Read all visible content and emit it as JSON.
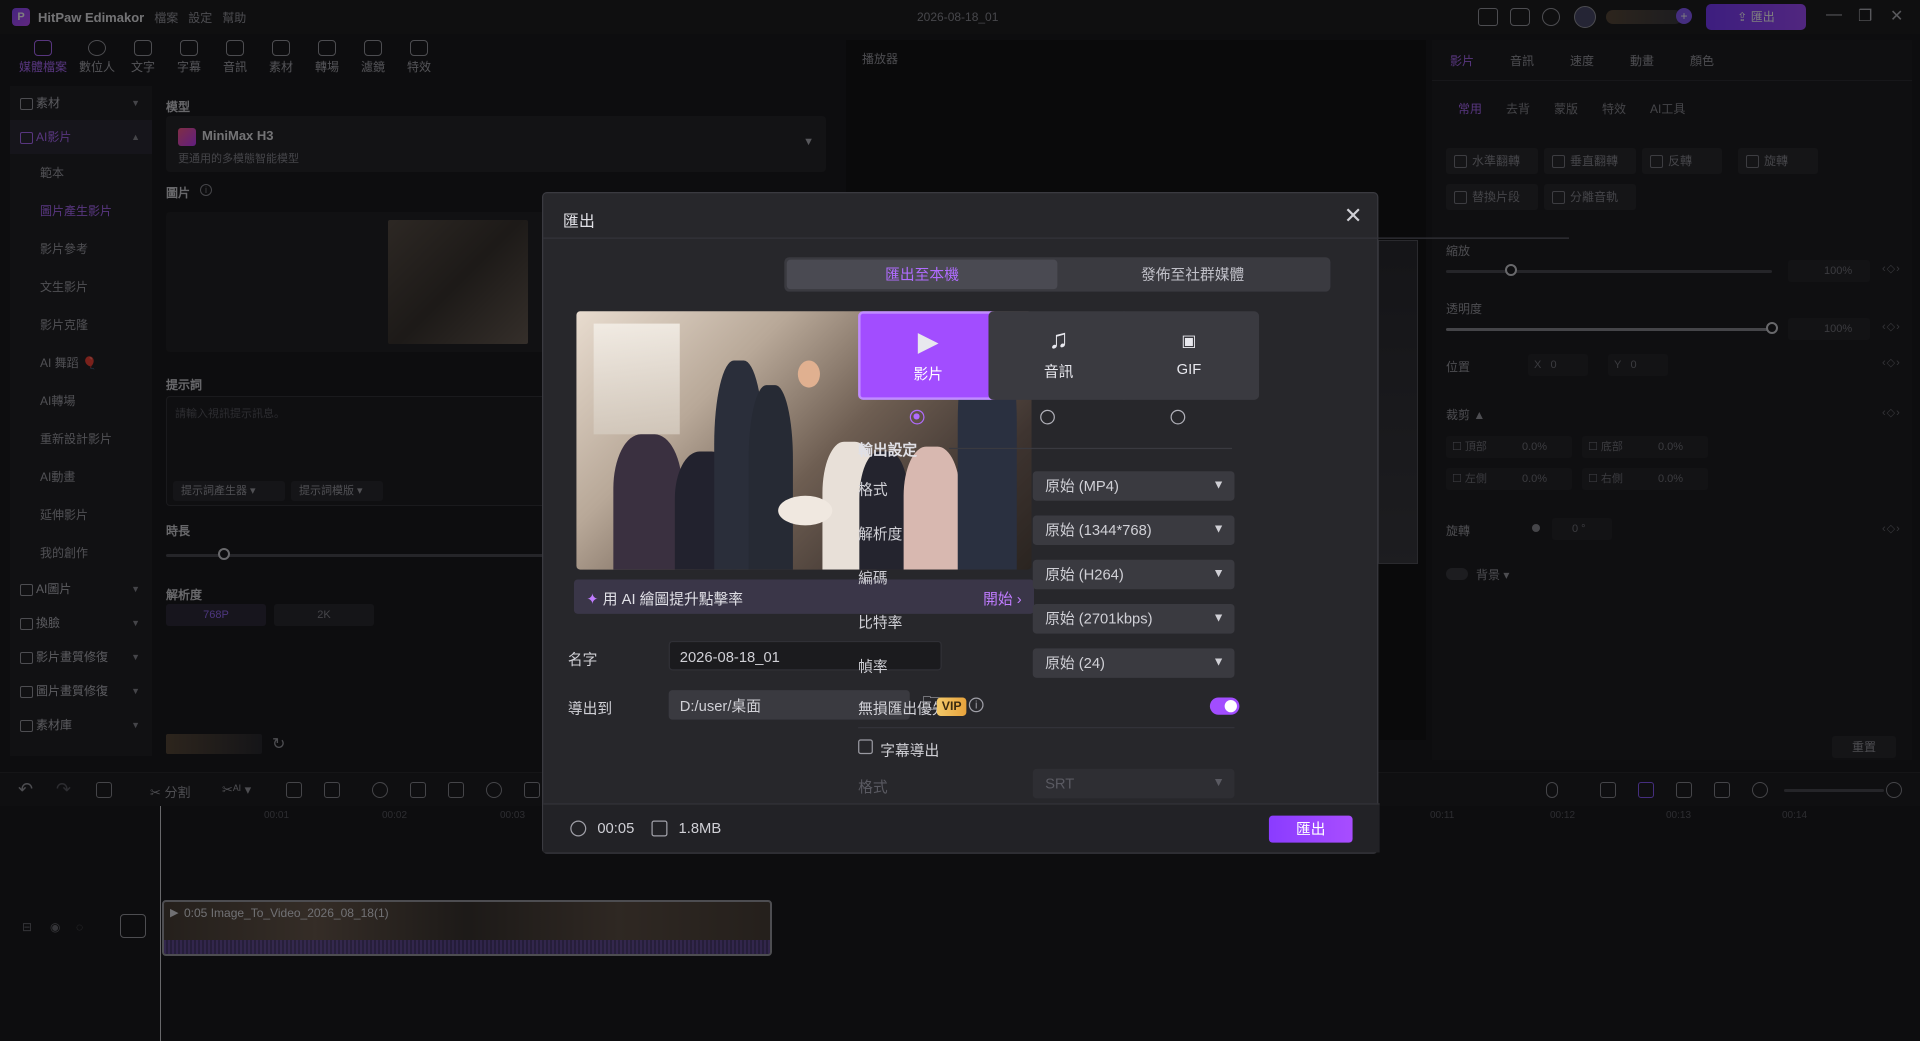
{
  "titlebar": {
    "app_name": "HitPaw Edimakor",
    "menu": [
      "檔案",
      "設定",
      "幫助"
    ],
    "document_title": "2026-08-18_01",
    "export_label": "匯出"
  },
  "tool_tabs": [
    {
      "label": "媒體檔案",
      "icon": "media-icon",
      "active": true
    },
    {
      "label": "數位人",
      "icon": "avatar-icon",
      "active": false
    },
    {
      "label": "文字",
      "icon": "text-icon",
      "active": false
    },
    {
      "label": "字幕",
      "icon": "subtitle-icon",
      "active": false
    },
    {
      "label": "音訊",
      "icon": "audio-icon",
      "active": false
    },
    {
      "label": "素材",
      "icon": "assets-icon",
      "active": false
    },
    {
      "label": "轉場",
      "icon": "transition-icon",
      "active": false
    },
    {
      "label": "濾鏡",
      "icon": "filter-icon",
      "active": false
    },
    {
      "label": "特效",
      "icon": "effects-icon",
      "active": false
    }
  ],
  "leftnav": {
    "group_assets": "素材",
    "group_ai_video": "AI影片",
    "ai_video_items": [
      "範本",
      "圖片產生影片",
      "影片參考",
      "文生影片",
      "影片克隆",
      "AI 舞蹈 🎈",
      "AI轉場",
      "重新設計影片",
      "AI動畫",
      "延伸影片",
      "我的創作"
    ],
    "active_item": "圖片產生影片",
    "group_ai_image": "AI圖片",
    "group_faceswap": "換臉",
    "group_video_restore": "影片畫質修復",
    "group_image_restore": "圖片畫質修復",
    "group_library": "素材庫"
  },
  "gen_panel": {
    "model_label": "模型",
    "model_name": "MiniMax H3",
    "model_desc": "更通用的多模態智能模型",
    "image_label": "圖片",
    "prompt_label": "提示詞",
    "prompt_placeholder": "請輸入視訊提示訊息。",
    "prompt_gen_btn": "提示詞產生器",
    "prompt_tpl_btn": "提示詞模版",
    "duration_label": "時長",
    "resolution_label": "解析度",
    "res_options": [
      "768P",
      "2K"
    ]
  },
  "player": {
    "title": "播放器"
  },
  "rightpanel": {
    "tabs": [
      "影片",
      "音訊",
      "速度",
      "動畫",
      "顏色"
    ],
    "subtabs": [
      "常用",
      "去背",
      "蒙版",
      "特效",
      "AI工具"
    ],
    "buttons_row1": [
      "水準翻轉",
      "垂直翻轉",
      "反轉",
      "旋轉"
    ],
    "buttons_row2": [
      "替換片段",
      "分離音軌"
    ],
    "scale_label": "縮放",
    "scale_value": "100%",
    "scale_fraction": 0.2,
    "opacity_label": "透明度",
    "opacity_value": "100%",
    "opacity_fraction": 1.0,
    "position_label": "位置",
    "pos_x_label": "X",
    "pos_x": "0",
    "pos_y_label": "Y",
    "pos_y": "0",
    "crop_label": "裁剪",
    "crop_top": "頂部",
    "crop_bottom": "底部",
    "crop_left": "左側",
    "crop_right": "右側",
    "crop_value": "0.0%",
    "rotate_label": "旋轉",
    "rotate_value": "0 °",
    "bg_label": "背景",
    "reset": "重置"
  },
  "timeline": {
    "split_label": "分割",
    "ticks": [
      "00:01",
      "00:02",
      "00:03",
      "00:11",
      "00:12",
      "00:13",
      "00:14"
    ],
    "clip_title": "0:05 Image_To_Video_2026_08_18(1)"
  },
  "export_dialog": {
    "title": "匯出",
    "tab_local": "匯出至本機",
    "tab_social": "發佈至社群媒體",
    "ai_upscale": "用 AI 繪圖提升點擊率",
    "ai_start": "開始",
    "name_label": "名字",
    "name_value": "2026-08-18_01",
    "export_to_label": "導出到",
    "export_path": "D:/user/桌面",
    "formats": [
      {
        "label": "影片",
        "icon": "video-icon",
        "selected": true
      },
      {
        "label": "音訊",
        "icon": "music-note-icon",
        "selected": false
      },
      {
        "label": "GIF",
        "icon": "gif-icon",
        "selected": false
      }
    ],
    "output_settings": "輸出設定",
    "format_label": "格式",
    "format_value": "原始 (MP4)",
    "resolution_label": "解析度",
    "resolution_value": "原始 (1344*768)",
    "encoder_label": "編碼",
    "encoder_value": "原始 (H264)",
    "bitrate_label": "比特率",
    "bitrate_value": "原始 (2701kbps)",
    "fps_label": "幀率",
    "fps_value": "原始 (24)",
    "lossless_label": "無損匯出優先",
    "vip_badge": "VIP",
    "lossless_on": true,
    "subtitle_export_label": "字幕導出",
    "subtitle_format_label": "格式",
    "subtitle_format_value": "SRT",
    "duration": "00:05",
    "filesize": "1.8MB",
    "export_btn": "匯出"
  }
}
